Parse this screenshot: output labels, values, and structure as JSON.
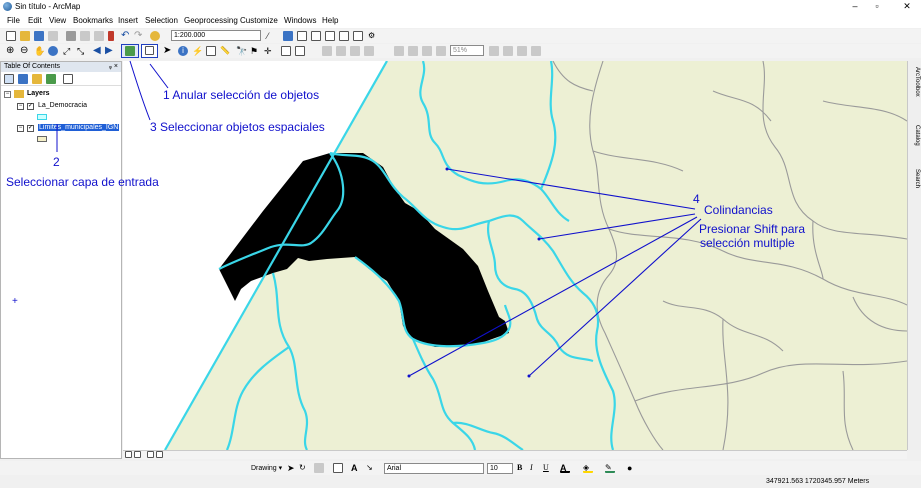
{
  "window": {
    "title": "Sin título - ArcMap"
  },
  "menu": [
    "File",
    "Edit",
    "View",
    "Bookmarks",
    "Insert",
    "Selection",
    "Geoprocessing",
    "Customize",
    "Windows",
    "Help"
  ],
  "toolbar": {
    "scale_value": "1:200.000",
    "zoom_percent": "51%"
  },
  "toc": {
    "title": "Table Of Contents",
    "pin": "ᵩ ×",
    "root": "Layers",
    "layers": [
      {
        "name": "La_Democracia",
        "checked": true,
        "color": "#ccffff"
      },
      {
        "name": "Limites_municipales_IGN",
        "checked": true,
        "color": "#f5f0c8",
        "selected": true
      }
    ]
  },
  "side_tabs": [
    "ArcToolbox",
    "Catalog",
    "Search"
  ],
  "drawing": {
    "label": "Drawing ▾",
    "font": "Arial",
    "size": "10"
  },
  "status": {
    "coordinates": "347921.563  1720345.957 Meters"
  },
  "colors": {
    "map_fill": "#edf0d4",
    "selection_fill": "#ccf5e8",
    "boundary_selected": "#3ad6e8",
    "boundary": "#9a9a9a",
    "annotation": "#1010cc"
  },
  "annotations": {
    "a1": "1 Anular selección de objetos",
    "a3": "3 Seleccionar objetos espaciales",
    "a2_num": "2",
    "a2_text": "Seleccionar capa de entrada",
    "a4_num": "4",
    "a4_title": "Colindancias",
    "a4_l1": "Presionar Shift para",
    "a4_l2": "selección multiple",
    "plus": "+"
  }
}
